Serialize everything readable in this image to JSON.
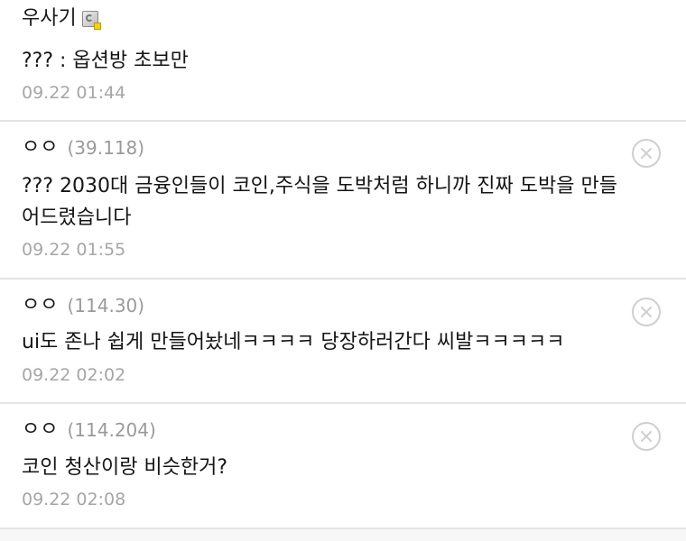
{
  "comments": [
    {
      "nickname": "우사기",
      "ip": "",
      "text_lines": [
        "??? : 옵션방 초보만"
      ],
      "time": "09.22 01:44",
      "has_fixed_nick_icon": true,
      "has_delete_button": false
    },
    {
      "nickname": "ㅇㅇ",
      "ip": "(39.118)",
      "text_lines": [
        "??? 2030대 금융인들이 코인,주식을 도박처럼 하니까 진짜 도박을 만들",
        "어드렸습니다"
      ],
      "time": "09.22 01:55",
      "has_delete_button": true
    },
    {
      "nickname": "ㅇㅇ",
      "ip": "(114.30)",
      "text_lines": [
        "ui도 존나 쉽게 만들어놨네ㅋㅋㅋㅋ 당장하러간다 씨발ㅋㅋㅋㅋㅋ"
      ],
      "time": "09.22 02:02",
      "has_delete_button": true
    },
    {
      "nickname": "ㅇㅇ",
      "ip": "(114.204)",
      "text_lines": [
        "코인 청산이랑 비슷한거?"
      ],
      "time": "09.22 02:08",
      "has_delete_button": true
    }
  ],
  "colors": {
    "text": "#151515",
    "meta": "#a6a6a6",
    "divider": "#e4e4e4",
    "delete_icon": "#cfcfcf"
  }
}
